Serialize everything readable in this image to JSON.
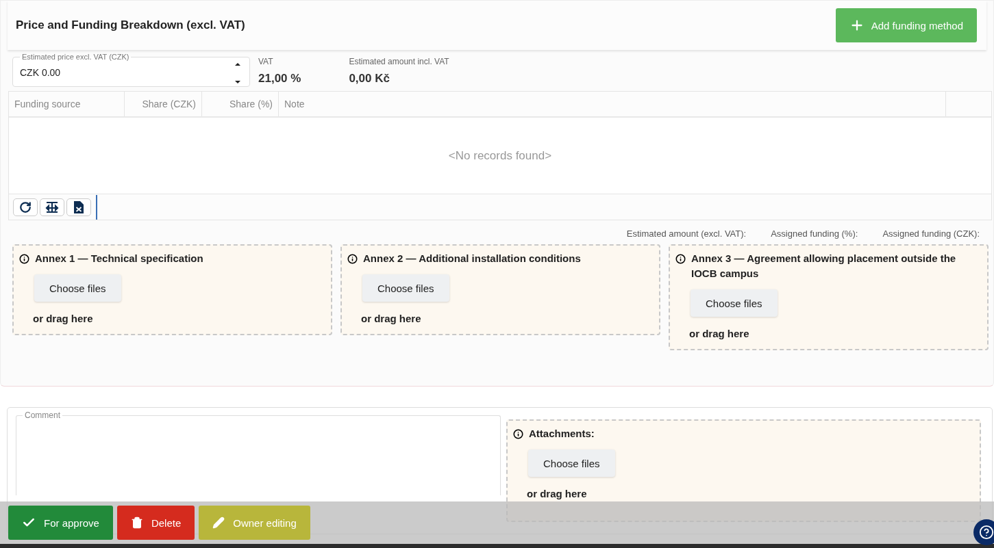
{
  "header": {
    "title": "Price and Funding Breakdown (excl. VAT)",
    "add_button": "Add funding method"
  },
  "price_field": {
    "label": "Estimated price excl. VAT (CZK)",
    "value": "CZK 0.00"
  },
  "vat": {
    "label": "VAT",
    "value": "21,00 %"
  },
  "amount_incl_vat": {
    "label": "Estimated amount incl. VAT",
    "value": "0,00 Kč"
  },
  "table": {
    "columns": [
      "Funding source",
      "Share (CZK)",
      "Share (%)",
      "Note"
    ],
    "empty_text": "<No records found>"
  },
  "summary": [
    "Estimated amount (excl. VAT):",
    "Assigned funding (%):",
    "Assigned funding (CZK):"
  ],
  "annexes": [
    {
      "title": "Annex 1 — Technical specification",
      "button": "Choose files",
      "hint": "or drag here"
    },
    {
      "title": "Annex 2 — Additional installation conditions",
      "button": "Choose files",
      "hint": "or drag here"
    },
    {
      "title": "Annex 3 — Agreement allowing placement outside the IOCB campus",
      "button": "Choose files",
      "hint": "or drag here"
    }
  ],
  "comment": {
    "label": "Comment"
  },
  "attachments": {
    "title": "Attachments:",
    "button": "Choose files",
    "hint": "or drag here"
  },
  "actions": [
    {
      "kind": "approve",
      "label": "For approve"
    },
    {
      "kind": "delete",
      "label": "Delete"
    },
    {
      "kind": "edit",
      "label": "Owner editing"
    }
  ]
}
